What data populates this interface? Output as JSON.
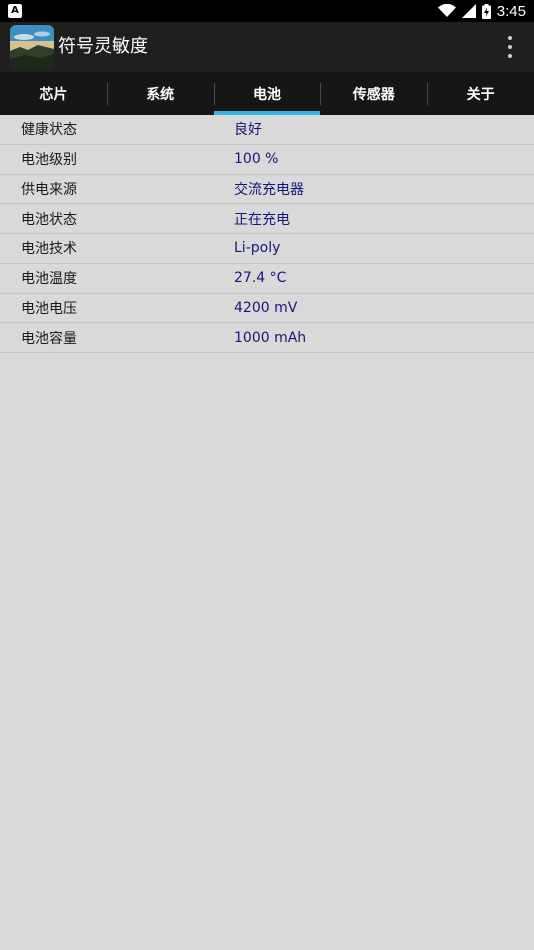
{
  "status_bar": {
    "badge": "A",
    "time": "3:45"
  },
  "app_bar": {
    "title": "符号灵敏度",
    "icon": "app-landscape-icon"
  },
  "tabs": [
    {
      "label": "芯片",
      "active": false
    },
    {
      "label": "系统",
      "active": false
    },
    {
      "label": "电池",
      "active": true
    },
    {
      "label": "传感器",
      "active": false
    },
    {
      "label": "关于",
      "active": false
    }
  ],
  "battery": {
    "rows": [
      {
        "label": "健康状态",
        "value": "良好"
      },
      {
        "label": "电池级别",
        "value": "100 %"
      },
      {
        "label": "供电来源",
        "value": "交流充电器"
      },
      {
        "label": "电池状态",
        "value": "正在充电"
      },
      {
        "label": "电池技术",
        "value": "Li-poly"
      },
      {
        "label": "电池温度",
        "value": "27.4 °C"
      },
      {
        "label": "电池电压",
        "value": "4200 mV"
      },
      {
        "label": "电池容量",
        "value": "1000 mAh"
      }
    ]
  },
  "colors": {
    "accent": "#33b5e5",
    "value_text": "#16167a",
    "background": "#d9d9d9"
  }
}
